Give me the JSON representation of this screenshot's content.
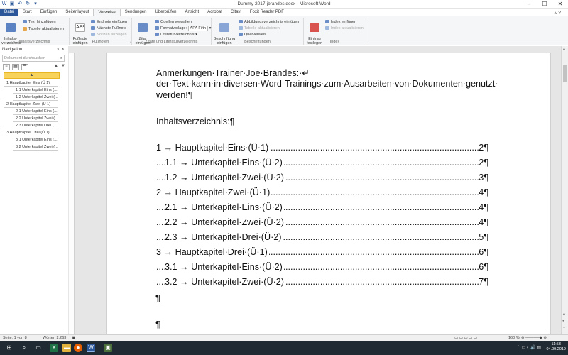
{
  "window": {
    "title": "Dummy-2017-jbrandes.docx - Microsoft Word"
  },
  "tabs": [
    "Datei",
    "Start",
    "Einfügen",
    "Seitenlayout",
    "Verweise",
    "Sendungen",
    "Überprüfen",
    "Ansicht",
    "Acrobat",
    "Citavi",
    "Foxit Reader PDF"
  ],
  "ribbon": {
    "toc": {
      "big": "Inhalts-\nverzeichnis",
      "add_text": "Text hinzufügen",
      "update": "Tabelle aktualisieren",
      "label": "Inhaltsverzeichnis"
    },
    "footnotes": {
      "big": "Fußnote\neinfügen",
      "endnote": "Endnote einfügen",
      "next": "Nächste Fußnote",
      "show": "Notizen anzeigen",
      "label": "Fußnoten"
    },
    "citations": {
      "big": "Zitat\neinfügen",
      "manage": "Quellen verwalten",
      "style_label": "Formatvorlage:",
      "style_value": "APA Fifth",
      "bibliography": "Literaturverzeichnis",
      "label": "Zitate und Literaturverzeichnis"
    },
    "captions": {
      "big": "Beschriftung\neinfügen",
      "figures": "Abbildungsverzeichnis einfügen",
      "update": "Tabelle aktualisieren",
      "crossref": "Querverweis",
      "label": "Beschriftungen"
    },
    "index": {
      "big": "Eintrag\nfestlegen",
      "insert": "Index einfügen",
      "update": "Index aktualisieren",
      "label": "Index"
    }
  },
  "navigation": {
    "title": "Navigation",
    "search_placeholder": "Dokument durchsuchen",
    "items": [
      {
        "level": 1,
        "label": "1 Hauptkapitel Eins (Ü 1)"
      },
      {
        "level": 2,
        "label": "1.1 Unterkapitel Eins (..."
      },
      {
        "level": 2,
        "label": "1.2 Unterkapitel Zwei (..."
      },
      {
        "level": 1,
        "label": "2 Hauptkapitel Zwei (Ü 1)"
      },
      {
        "level": 2,
        "label": "2.1 Unterkapitel Eins (..."
      },
      {
        "level": 2,
        "label": "2.2 Unterkapitel Zwei (..."
      },
      {
        "level": 2,
        "label": "2.3 Unterkapitel Drei (..."
      },
      {
        "level": 1,
        "label": "3 Hauptkapitel Drei (Ü 1)"
      },
      {
        "level": 2,
        "label": "3.1 Unterkapitel Eins (..."
      },
      {
        "level": 2,
        "label": "3.2 Unterkapitel Zwei (..."
      }
    ]
  },
  "document": {
    "line1": "Anmerkungen·Trainer·Joe·Brandes:·↵",
    "line2": "der·Text·kann·in·diversen·Word-Trainings·zum·Ausarbeiten·von·Dokumenten·genutzt·",
    "line3": "werden!¶",
    "heading": "Inhaltsverzeichnis:¶",
    "toc": [
      {
        "level": 1,
        "label": "1 → Hauptkapitel·Eins·(Ü·1)",
        "page": "2¶"
      },
      {
        "level": 2,
        "label": "1.1 → Unterkapitel·Eins·(Ü·2)",
        "page": "2¶"
      },
      {
        "level": 2,
        "label": "1.2 → Unterkapitel·Zwei·(Ü·2)",
        "page": "3¶"
      },
      {
        "level": 1,
        "label": "2 → Hauptkapitel·Zwei·(Ü·1)",
        "page": "4¶"
      },
      {
        "level": 2,
        "label": "2.1 → Unterkapitel·Eins·(Ü·2)",
        "page": "4¶"
      },
      {
        "level": 2,
        "label": "2.2 → Unterkapitel·Zwei·(Ü·2)",
        "page": "4¶"
      },
      {
        "level": 2,
        "label": "2.3 → Unterkapitel·Drei·(Ü·2)",
        "page": "5¶"
      },
      {
        "level": 1,
        "label": "3 → Hauptkapitel·Drei·(Ü·1)",
        "page": "6¶"
      },
      {
        "level": 2,
        "label": "3.1 → Unterkapitel·Eins·(Ü·2)",
        "page": "6¶"
      },
      {
        "level": 2,
        "label": "3.2 → Unterkapitel·Zwei·(Ü·2)",
        "page": "7¶"
      }
    ],
    "para_mark": "¶"
  },
  "status": {
    "page": "Seite: 1 von 8",
    "words": "Wörter: 2.263",
    "zoom": "160 %"
  },
  "taskbar": {
    "time": "11:53",
    "date": "04.09.2019"
  },
  "colors": {
    "accent": "#2b579a",
    "highlight": "#f8d35b",
    "taskbar": "#1f2a33"
  }
}
